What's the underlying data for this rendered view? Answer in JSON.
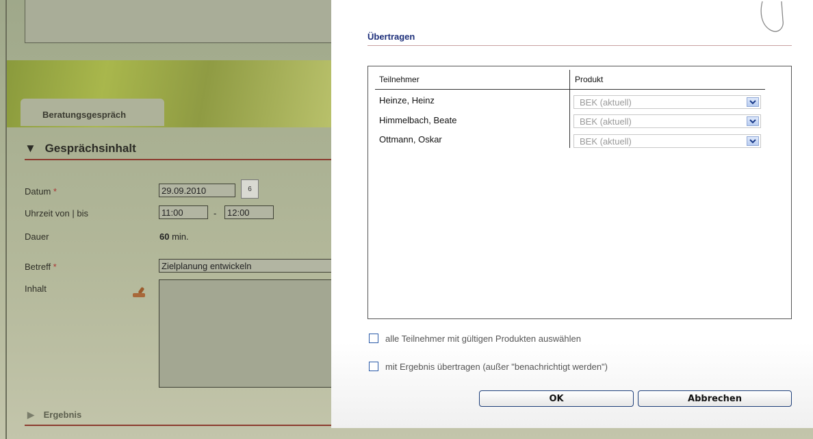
{
  "background": {
    "tab_label": "Beratungsgespräch",
    "section_title": "Gesprächsinhalt",
    "section_arrow": "▼",
    "fields": {
      "datum_label": "Datum",
      "datum_value": "29.09.2010",
      "calendar_day": "6",
      "uhrzeit_label": "Uhrzeit von | bis",
      "von_value": "11:00",
      "bis_value": "12:00",
      "dash": "-",
      "dauer_label": "Dauer",
      "dauer_value": "60",
      "dauer_unit": " min.",
      "betreff_label": "Betreff",
      "betreff_value": "Zielplanung entwickeln",
      "inhalt_label": "Inhalt",
      "required_marker": " *"
    },
    "ergebnis_label": "Ergebnis",
    "ergebnis_arrow": "▶"
  },
  "dialog": {
    "title": "Übertragen",
    "columns": {
      "participant": "Teilnehmer",
      "product": "Produkt"
    },
    "rows": [
      {
        "name": "Heinze, Heinz",
        "product": "BEK (aktuell)"
      },
      {
        "name": "Himmelbach, Beate",
        "product": "BEK (aktuell)"
      },
      {
        "name": "Ottmann, Oskar",
        "product": "BEK (aktuell)"
      }
    ],
    "checkbox_all": "alle Teilnehmer mit gültigen Produkten auswählen",
    "checkbox_result": "mit Ergebnis übertragen (außer \"benachrichtigt werden\")",
    "ok_label": "OK",
    "cancel_label": "Abbrechen"
  }
}
